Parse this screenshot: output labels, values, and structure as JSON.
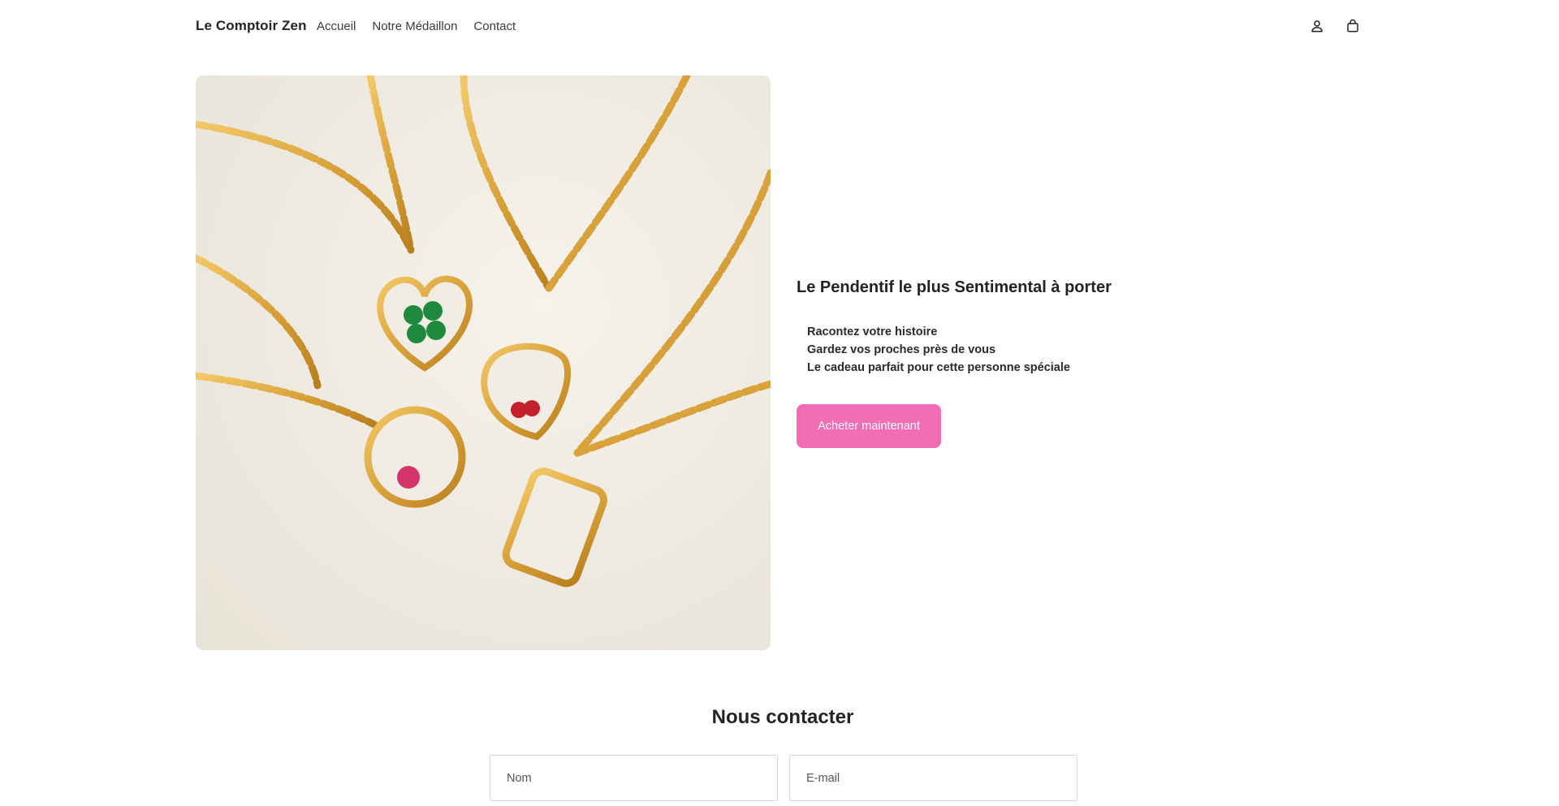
{
  "header": {
    "brand": "Le Comptoir Zen",
    "nav": [
      {
        "label": "Accueil"
      },
      {
        "label": "Notre Médaillon"
      },
      {
        "label": "Contact"
      }
    ],
    "icons": [
      "account-icon",
      "shopping-bag-icon"
    ]
  },
  "hero": {
    "heading": "Le Pendentif le plus Sentimental à porter",
    "bullets": [
      "Racontez votre histoire",
      "Gardez vos proches près de vous",
      "Le cadeau parfait pour cette personne spéciale"
    ],
    "cta_label": "Acheter maintenant",
    "cta_color": "#f26db5"
  },
  "contact": {
    "title": "Nous contacter",
    "name_placeholder": "Nom",
    "email_placeholder": "E-mail"
  },
  "colors": {
    "accent": "#f26db5",
    "gold": "#d9a63a"
  }
}
